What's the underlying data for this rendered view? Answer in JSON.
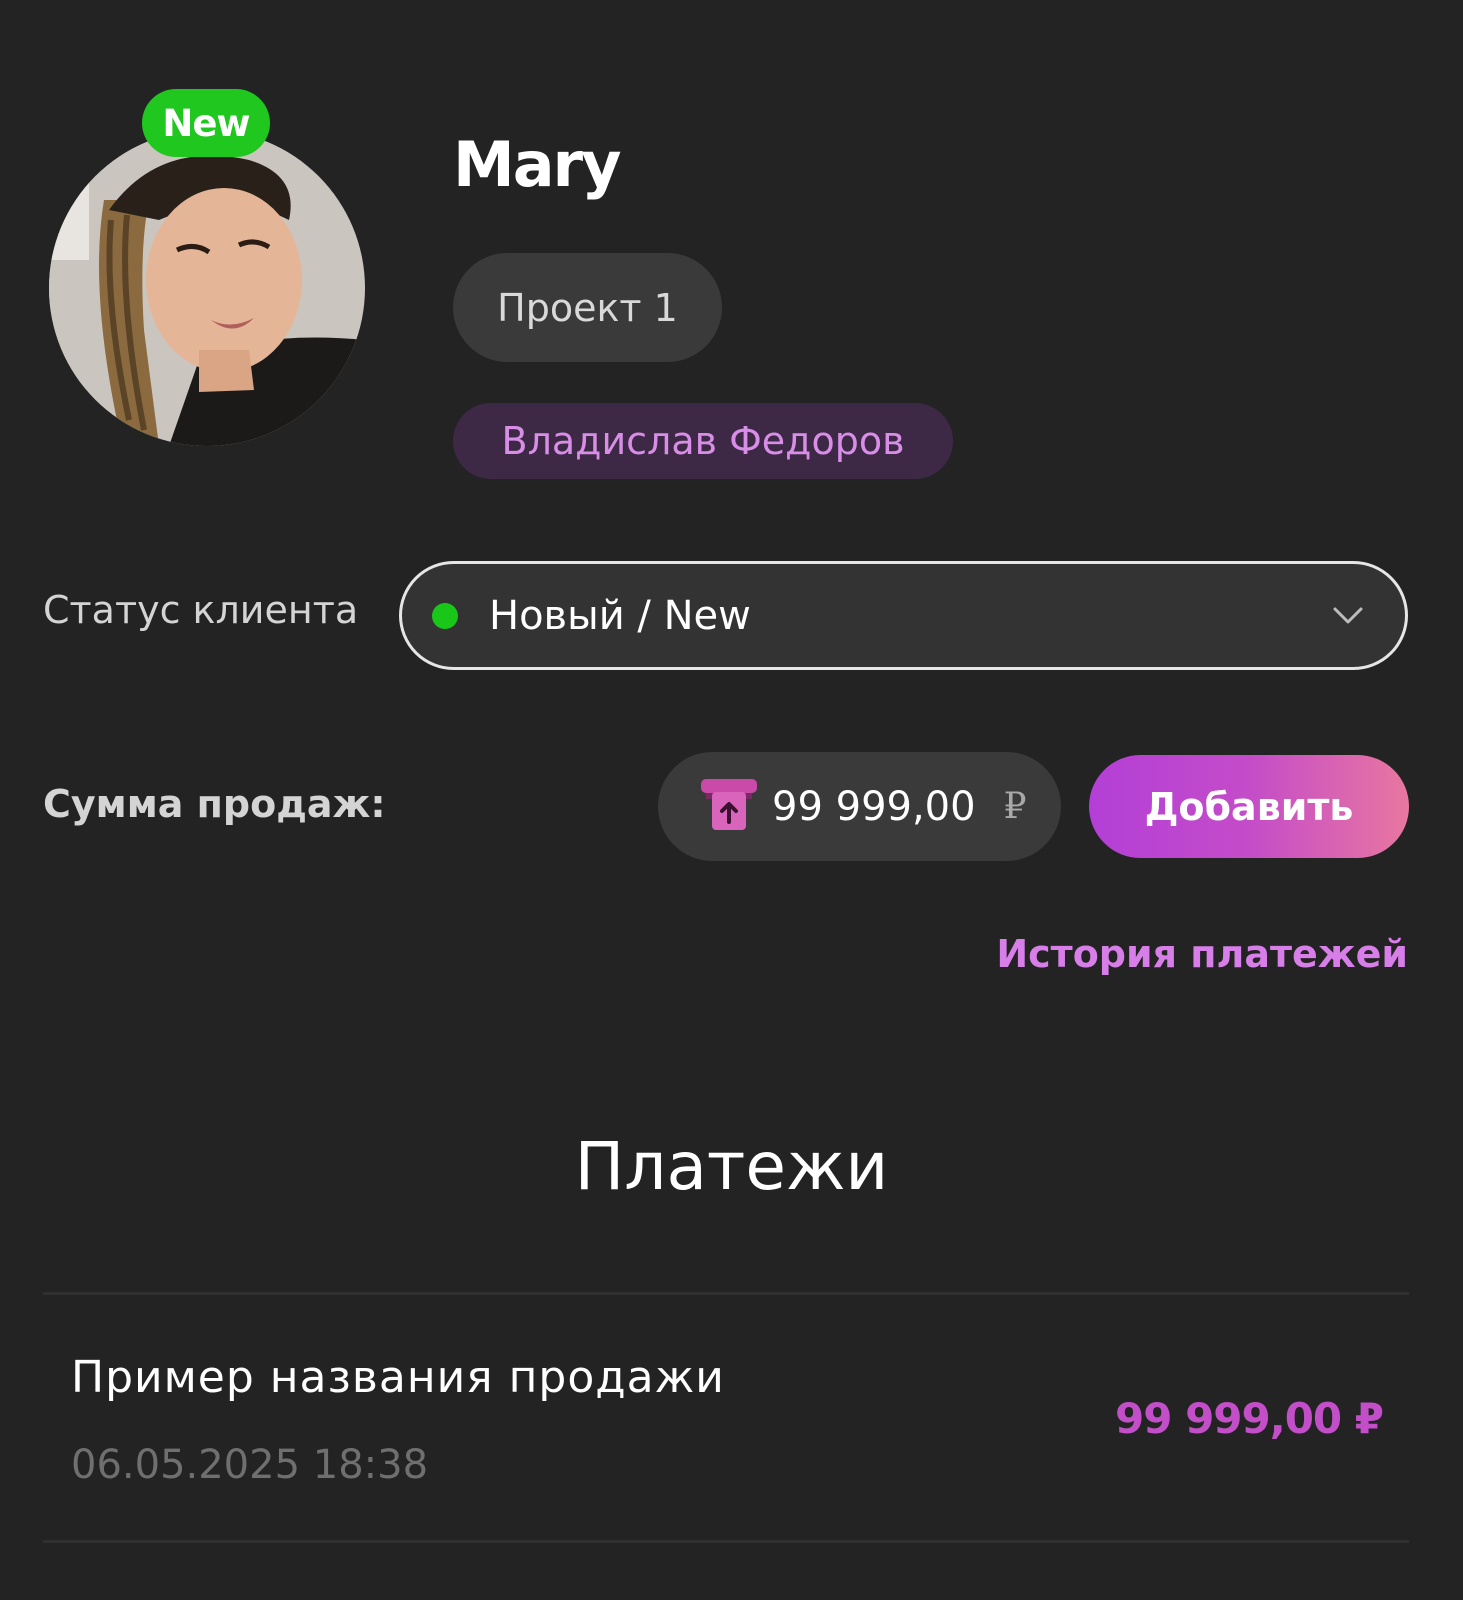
{
  "profile": {
    "badge": "New",
    "name": "Mary",
    "project": "Проект 1",
    "manager": "Владислав Федоров"
  },
  "status": {
    "label": "Статус клиента",
    "value": "Новый / New",
    "dot_color": "#19c719"
  },
  "sales": {
    "label": "Сумма продаж:",
    "amount": "99 999,00",
    "currency": "₽",
    "icon": "payment-terminal-icon",
    "add_label": "Добавить"
  },
  "history_link": "История платежей",
  "payments": {
    "title": "Платежи",
    "items": [
      {
        "name": "Пример названия продажи",
        "date": "06.05.2025 18:38",
        "amount": "99 999,00 ₽"
      }
    ]
  },
  "colors": {
    "background": "#232324",
    "accent": "#c24ec8",
    "accent_light": "#d77ee9",
    "badge_green": "#1fc71f"
  }
}
